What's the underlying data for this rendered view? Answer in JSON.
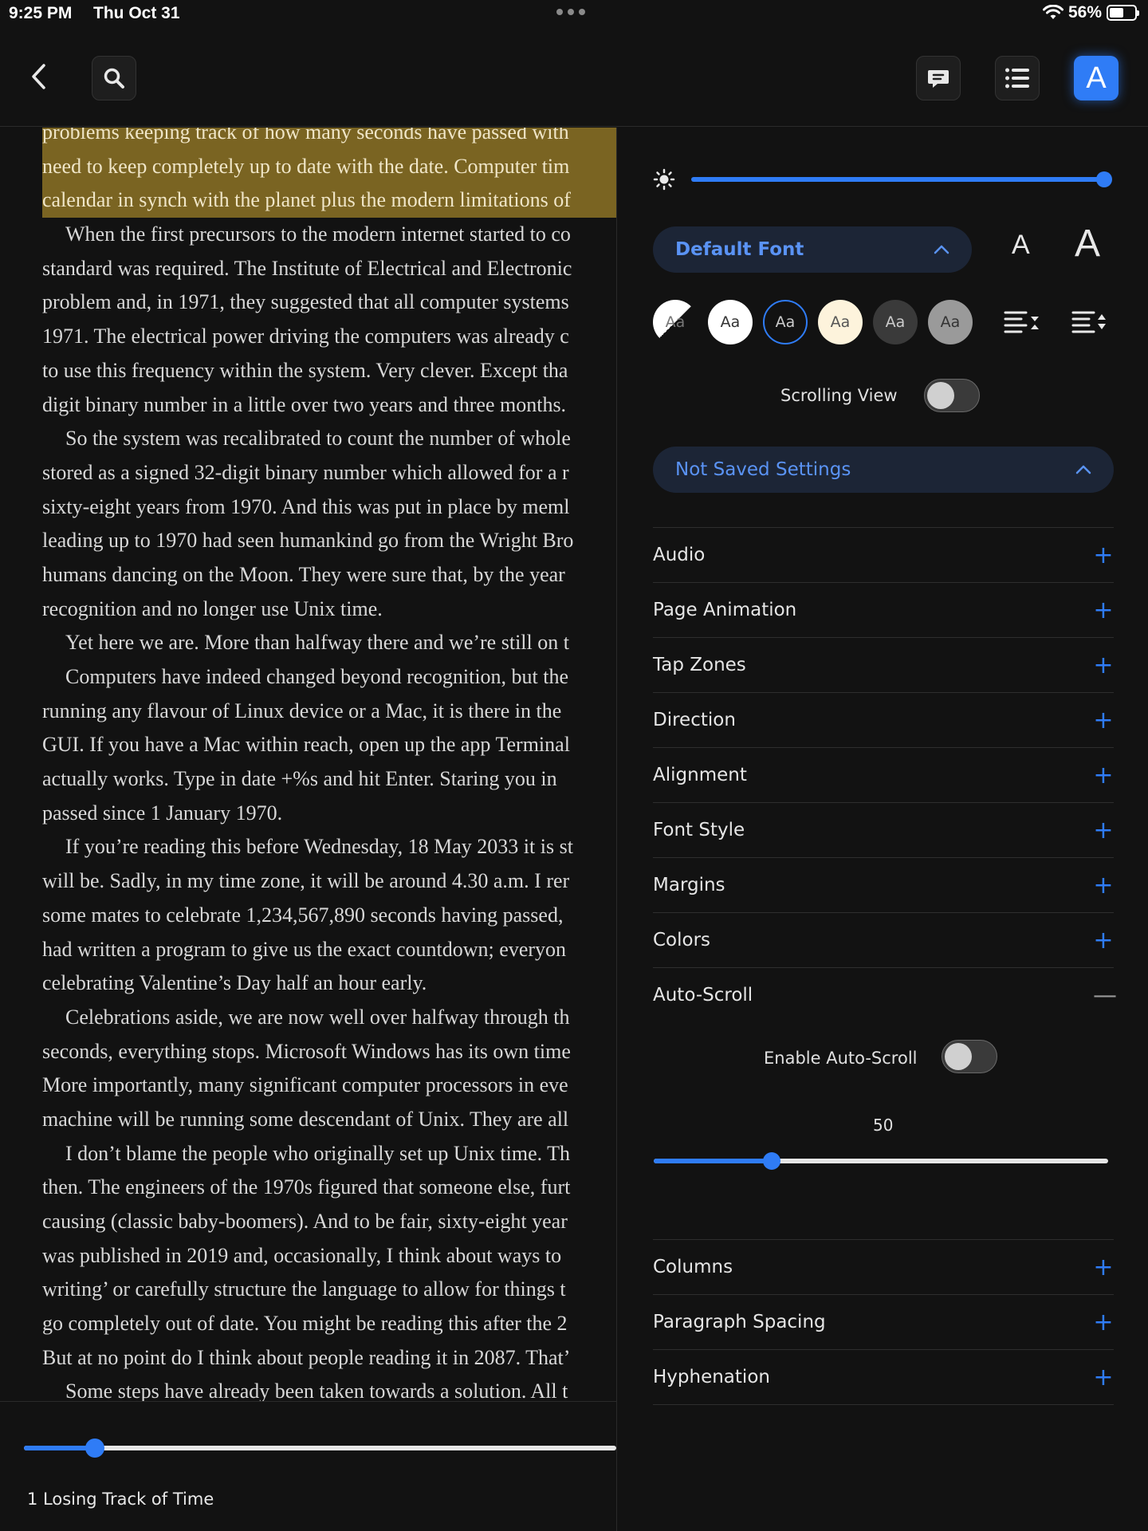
{
  "status_bar": {
    "time": "9:25 PM",
    "date": "Thu Oct 31",
    "battery": "56%",
    "battery_level": 0.56
  },
  "toolbar": {
    "aa_label": "A"
  },
  "book": {
    "lines": [
      {
        "text": "problems keeping track of how many seconds have passed with",
        "highlight": true,
        "indent": false
      },
      {
        "text": "need to keep completely up to date with the date. Computer tim",
        "highlight": true,
        "indent": false
      },
      {
        "text": "calendar in synch with the planet plus the modern limitations of",
        "highlight": true,
        "indent": false
      },
      {
        "text": "When the first precursors to the modern internet started to co",
        "highlight": false,
        "indent": true
      },
      {
        "text": "standard was required. The Institute of Electrical and Electronic",
        "highlight": false,
        "indent": false
      },
      {
        "text": "problem and, in 1971, they suggested that all computer systems",
        "highlight": false,
        "indent": false
      },
      {
        "text": "1971. The electrical power driving the computers was already c",
        "highlight": false,
        "indent": false
      },
      {
        "text": "to use this frequency within the system. Very clever. Except tha",
        "highlight": false,
        "indent": false
      },
      {
        "text": "digit binary number in a little over two years and three months.",
        "highlight": false,
        "indent": false
      },
      {
        "text": "So the system was recalibrated to count the number of whole",
        "highlight": false,
        "indent": true
      },
      {
        "text": "stored as a signed 32-digit binary number which allowed for a r",
        "highlight": false,
        "indent": false
      },
      {
        "text": "sixty-eight years from 1970. And this was put in place by meml",
        "highlight": false,
        "indent": false
      },
      {
        "text": "leading up to 1970 had seen humankind go from the Wright Bro",
        "highlight": false,
        "indent": false
      },
      {
        "text": "humans dancing on the Moon. They were sure that, by the year",
        "highlight": false,
        "indent": false
      },
      {
        "text": "recognition and no longer use Unix time.",
        "highlight": false,
        "indent": false
      },
      {
        "text": "Yet here we are. More than halfway there and we’re still on t",
        "highlight": false,
        "indent": true
      },
      {
        "text": "Computers have indeed changed beyond recognition, but the",
        "highlight": false,
        "indent": true
      },
      {
        "text": "running any flavour of Linux device or a Mac, it is there in the",
        "highlight": false,
        "indent": false
      },
      {
        "text": "GUI. If you have a Mac within reach, open up the app Terminal",
        "highlight": false,
        "indent": false
      },
      {
        "text": "actually works. Type in date +%s and hit Enter. Staring you in",
        "highlight": false,
        "indent": false
      },
      {
        "text": "passed since 1 January 1970.",
        "highlight": false,
        "indent": false
      },
      {
        "text": "If you’re reading this before Wednesday, 18 May 2033 it is st",
        "highlight": false,
        "indent": true
      },
      {
        "text": "will be. Sadly, in my time zone, it will be around 4.30 a.m. I rer",
        "highlight": false,
        "indent": false
      },
      {
        "text": "some mates to celebrate 1,234,567,890 seconds having passed,",
        "highlight": false,
        "indent": false
      },
      {
        "text": "had written a program to give us the exact countdown; everyon",
        "highlight": false,
        "indent": false
      },
      {
        "text": "celebrating Valentine’s Day half an hour early.",
        "highlight": false,
        "indent": false
      },
      {
        "text": "Celebrations aside, we are now well over halfway through th",
        "highlight": false,
        "indent": true
      },
      {
        "text": "seconds, everything stops. Microsoft Windows has its own time",
        "highlight": false,
        "indent": false
      },
      {
        "text": "More importantly, many significant computer processors in eve",
        "highlight": false,
        "indent": false
      },
      {
        "text": "machine will be running some descendant of Unix. They are all",
        "highlight": false,
        "indent": false
      },
      {
        "text": "I don’t blame the people who originally set up Unix time. Th",
        "highlight": false,
        "indent": true
      },
      {
        "text": "then. The engineers of the 1970s figured that someone else, furt",
        "highlight": false,
        "indent": false
      },
      {
        "text": "causing (classic baby-boomers). And to be fair, sixty-eight year",
        "highlight": false,
        "indent": false
      },
      {
        "text": "was published in 2019 and, occasionally, I think about ways to",
        "highlight": false,
        "indent": false
      },
      {
        "text": "writing’ or carefully structure the language to allow for things t",
        "highlight": false,
        "indent": false
      },
      {
        "text": "go completely out of date. You might be reading this after the 2",
        "highlight": false,
        "indent": false
      },
      {
        "text": "But at no point do I think about people reading it in 2087. That’",
        "highlight": false,
        "indent": false
      },
      {
        "text": "Some steps have already been taken towards a solution. All t",
        "highlight": false,
        "indent": true
      }
    ],
    "chapter": "1 Losing Track of Time",
    "progress": 0.12
  },
  "panel": {
    "brightness": 1.0,
    "font_dropdown": "Default Font",
    "font_smaller": "A",
    "font_larger": "A",
    "themes": [
      {
        "label": "Aa",
        "bg": "#ffffff",
        "fg": "#333333",
        "border": "none",
        "auto": true
      },
      {
        "label": "Aa",
        "bg": "#ffffff",
        "fg": "#333333",
        "border": "none",
        "auto": false
      },
      {
        "label": "Aa",
        "bg": "#121212",
        "fg": "#cccccc",
        "border": "#2f7cf6",
        "auto": false
      },
      {
        "label": "Aa",
        "bg": "#fdf3dc",
        "fg": "#555555",
        "border": "none",
        "auto": false
      },
      {
        "label": "Aa",
        "bg": "#3a3a3a",
        "fg": "#cccccc",
        "border": "none",
        "auto": false
      },
      {
        "label": "Aa",
        "bg": "#9a9a9a",
        "fg": "#333333",
        "border": "none",
        "auto": false
      }
    ],
    "scrolling_view_label": "Scrolling View",
    "scrolling_view_on": false,
    "saved_settings_dropdown": "Not Saved Settings",
    "sections_top": [
      "Audio",
      "Page Animation",
      "Tap Zones",
      "Direction",
      "Alignment",
      "Font Style",
      "Margins",
      "Colors"
    ],
    "autoscroll": {
      "title": "Auto-Scroll",
      "enable_label": "Enable Auto-Scroll",
      "enabled": false,
      "speed": "50",
      "speed_fraction": 0.26
    },
    "sections_bottom": [
      "Columns",
      "Paragraph Spacing",
      "Hyphenation"
    ],
    "colors": {
      "accent": "#2f7cf6",
      "highlight": "#7a6422",
      "dropdown_bg": "#1c2536"
    }
  }
}
